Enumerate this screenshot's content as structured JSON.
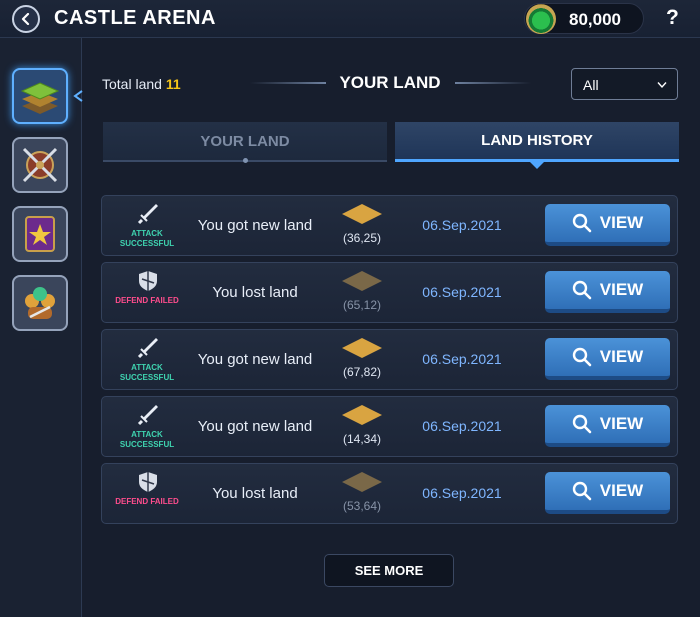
{
  "header": {
    "title": "CASTLE ARENA",
    "coins": "80,000",
    "help": "?"
  },
  "sidebar": {
    "items": [
      {
        "icon": "land-layers-icon",
        "active": true
      },
      {
        "icon": "crossed-swords-shield-icon",
        "active": false
      },
      {
        "icon": "spellbook-icon",
        "active": false
      },
      {
        "icon": "team-members-icon",
        "active": false
      }
    ]
  },
  "summary": {
    "total_label": "Total land",
    "total_value": "11"
  },
  "section_title": "YOUR LAND",
  "filter": {
    "selected": "All"
  },
  "tabs": [
    {
      "label": "YOUR LAND",
      "active": false
    },
    {
      "label": "LAND HISTORY",
      "active": true
    }
  ],
  "history": [
    {
      "status": "success",
      "status_line1": "ATTACK",
      "status_line2": "SUCCESSFUL",
      "message": "You got new land",
      "coord": "(36,25)",
      "date": "06.Sep.2021",
      "action": "VIEW"
    },
    {
      "status": "fail",
      "status_line1": "DEFEND FAILED",
      "status_line2": "",
      "message": "You lost land",
      "coord": "(65,12)",
      "date": "06.Sep.2021",
      "action": "VIEW"
    },
    {
      "status": "success",
      "status_line1": "ATTACK",
      "status_line2": "SUCCESSFUL",
      "message": "You got new land",
      "coord": "(67,82)",
      "date": "06.Sep.2021",
      "action": "VIEW"
    },
    {
      "status": "success",
      "status_line1": "ATTACK",
      "status_line2": "SUCCESSFUL",
      "message": "You got new land",
      "coord": "(14,34)",
      "date": "06.Sep.2021",
      "action": "VIEW"
    },
    {
      "status": "fail",
      "status_line1": "DEFEND FAILED",
      "status_line2": "",
      "message": "You lost land",
      "coord": "(53,64)",
      "date": "06.Sep.2021",
      "action": "VIEW"
    }
  ],
  "see_more": "SEE MORE",
  "colors": {
    "accent": "#4fa6ff",
    "success": "#3fd4b0",
    "fail": "#ff4d8d",
    "date": "#7fb6ff",
    "land_won": "#d9a441",
    "land_lost": "#7a6848"
  }
}
